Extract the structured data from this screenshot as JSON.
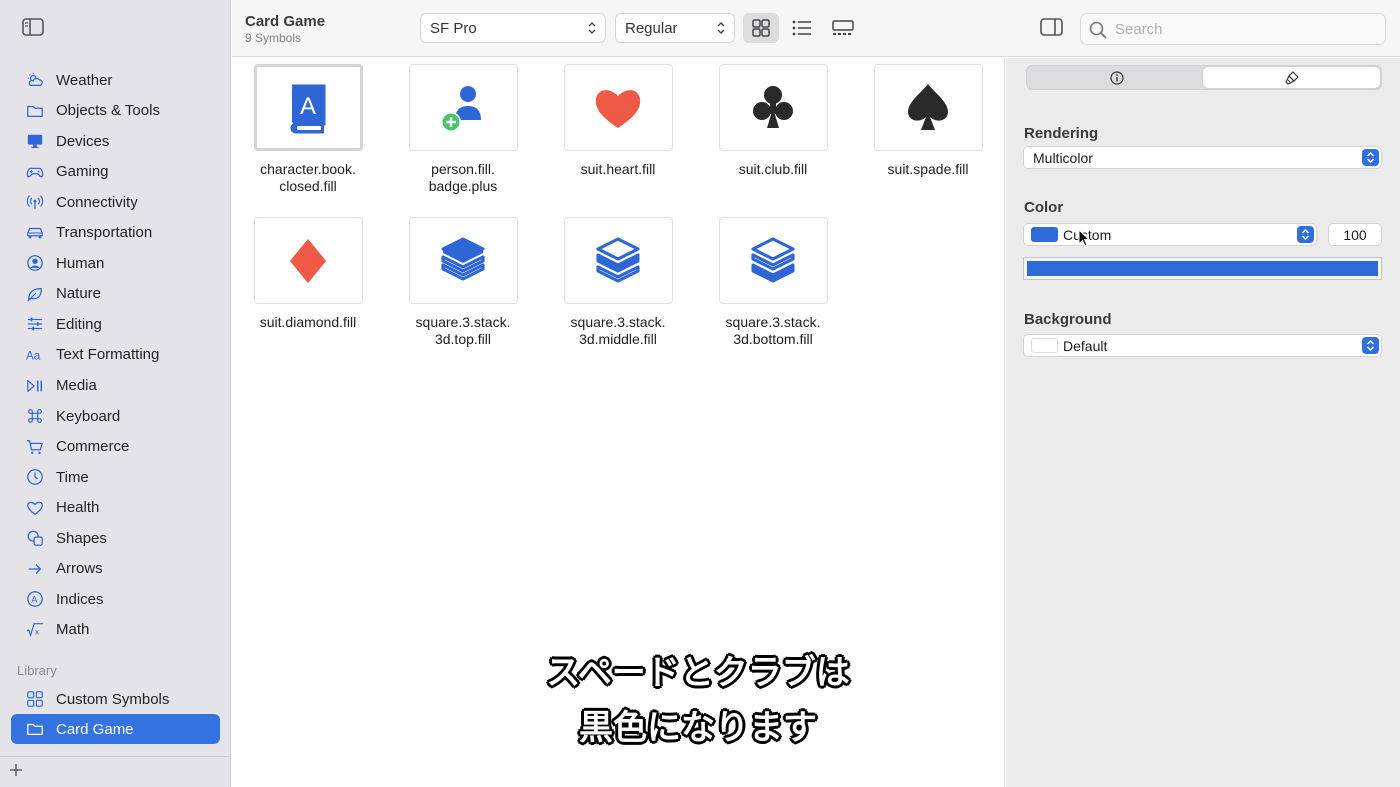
{
  "toolbar": {
    "collection_title": "Card Game",
    "collection_count": "9 Symbols",
    "font_value": "SF Pro",
    "weight_value": "Regular",
    "search_placeholder": "Search"
  },
  "sidebar": {
    "categories": [
      {
        "label": "Weather",
        "icon": "cloud-sun-icon"
      },
      {
        "label": "Objects & Tools",
        "icon": "folder-icon"
      },
      {
        "label": "Devices",
        "icon": "desktop-icon"
      },
      {
        "label": "Gaming",
        "icon": "gamecontroller-icon"
      },
      {
        "label": "Connectivity",
        "icon": "antenna-icon"
      },
      {
        "label": "Transportation",
        "icon": "car-icon"
      },
      {
        "label": "Human",
        "icon": "person-circle-icon"
      },
      {
        "label": "Nature",
        "icon": "leaf-icon"
      },
      {
        "label": "Editing",
        "icon": "sliders-icon"
      },
      {
        "label": "Text Formatting",
        "icon": "textformat-icon"
      },
      {
        "label": "Media",
        "icon": "playpause-icon"
      },
      {
        "label": "Keyboard",
        "icon": "command-icon"
      },
      {
        "label": "Commerce",
        "icon": "cart-icon"
      },
      {
        "label": "Time",
        "icon": "clock-icon"
      },
      {
        "label": "Health",
        "icon": "heart-icon"
      },
      {
        "label": "Shapes",
        "icon": "shapes-icon"
      },
      {
        "label": "Arrows",
        "icon": "arrow-right-icon"
      },
      {
        "label": "Indices",
        "icon": "a-circle-icon"
      },
      {
        "label": "Math",
        "icon": "sqrt-x-icon"
      }
    ],
    "library_header": "Library",
    "library_items": [
      {
        "label": "Custom Symbols",
        "icon": "grid-icon"
      },
      {
        "label": "Card Game",
        "icon": "folder-icon",
        "selected": true
      }
    ]
  },
  "symbols": [
    {
      "name": "character.book.\nclosed.fill",
      "icon": "character-book-closed-icon",
      "selected": true
    },
    {
      "name": "person.fill.\nbadge.plus",
      "icon": "person-badge-plus-icon"
    },
    {
      "name": "suit.heart.fill",
      "icon": "suit-heart-icon"
    },
    {
      "name": "suit.club.fill",
      "icon": "suit-club-icon"
    },
    {
      "name": "suit.spade.fill",
      "icon": "suit-spade-icon"
    },
    {
      "name": "suit.diamond.fill",
      "icon": "suit-diamond-icon"
    },
    {
      "name": "square.3.stack.\n3d.top.fill",
      "icon": "square-stack-top-icon"
    },
    {
      "name": "square.3.stack.\n3d.middle.fill",
      "icon": "square-stack-middle-icon"
    },
    {
      "name": "square.3.stack.\n3d.bottom.fill",
      "icon": "square-stack-bottom-icon"
    }
  ],
  "inspector": {
    "rendering_label": "Rendering",
    "rendering_value": "Multicolor",
    "color_label": "Color",
    "color_value": "Custom",
    "opacity_value": "100",
    "background_label": "Background",
    "background_value": "Default"
  },
  "caption": {
    "line1": "スペードとクラブは",
    "line2": "黒色になります"
  },
  "colors": {
    "accent": "#3473e0",
    "symbol_blue": "#2f66d6",
    "heart_red": "#ee5a45",
    "club_spade_black": "#2a2a2a",
    "badge_green": "#4cc36a",
    "custom_color": "#2f6bd8"
  }
}
